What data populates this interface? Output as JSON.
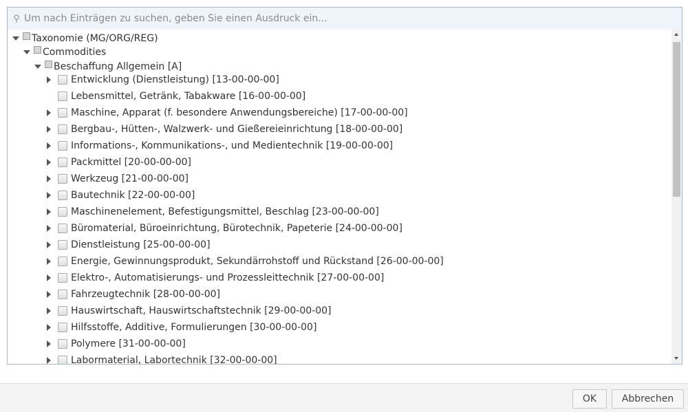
{
  "search": {
    "icon": "search-icon",
    "placeholder": "Um nach Einträgen zu suchen, geben Sie einen Ausdruck ein..."
  },
  "tree": {
    "root": "Taxonomie (MG/ORG/REG)",
    "level1": "Commodities",
    "level2": "Beschaffung Allgemein [A]",
    "items": [
      {
        "label": "Entwicklung (Dienstleistung) [13-00-00-00]",
        "expandable": true
      },
      {
        "label": "Lebensmittel, Getränk, Tabakware [16-00-00-00]",
        "expandable": false
      },
      {
        "label": "Maschine, Apparat (f. besondere Anwendungsbereiche) [17-00-00-00]",
        "expandable": true
      },
      {
        "label": "Bergbau-, Hütten-, Walzwerk- und Gießereieinrichtung [18-00-00-00]",
        "expandable": true
      },
      {
        "label": "Informations-, Kommunikations-, und Medientechnik [19-00-00-00]",
        "expandable": true
      },
      {
        "label": "Packmittel [20-00-00-00]",
        "expandable": true
      },
      {
        "label": "Werkzeug [21-00-00-00]",
        "expandable": true
      },
      {
        "label": "Bautechnik [22-00-00-00]",
        "expandable": true
      },
      {
        "label": "Maschinenelement, Befestigungsmittel, Beschlag [23-00-00-00]",
        "expandable": true
      },
      {
        "label": "Büromaterial, Büroeinrichtung, Bürotechnik, Papeterie [24-00-00-00]",
        "expandable": true
      },
      {
        "label": "Dienstleistung [25-00-00-00]",
        "expandable": true
      },
      {
        "label": "Energie, Gewinnungsprodukt, Sekundärrohstoff und Rückstand [26-00-00-00]",
        "expandable": true
      },
      {
        "label": "Elektro-, Automatisierungs- und Prozessleittechnik [27-00-00-00]",
        "expandable": true
      },
      {
        "label": "Fahrzeugtechnik [28-00-00-00]",
        "expandable": true
      },
      {
        "label": "Hauswirtschaft, Hauswirtschaftstechnik [29-00-00-00]",
        "expandable": true
      },
      {
        "label": "Hilfsstoffe, Additive, Formulierungen [30-00-00-00]",
        "expandable": true
      },
      {
        "label": "Polymere [31-00-00-00]",
        "expandable": true
      },
      {
        "label": "Labormaterial, Labortechnik [32-00-00-00]",
        "expandable": true
      }
    ]
  },
  "footer": {
    "ok_label": "OK",
    "cancel_label": "Abbrechen"
  }
}
